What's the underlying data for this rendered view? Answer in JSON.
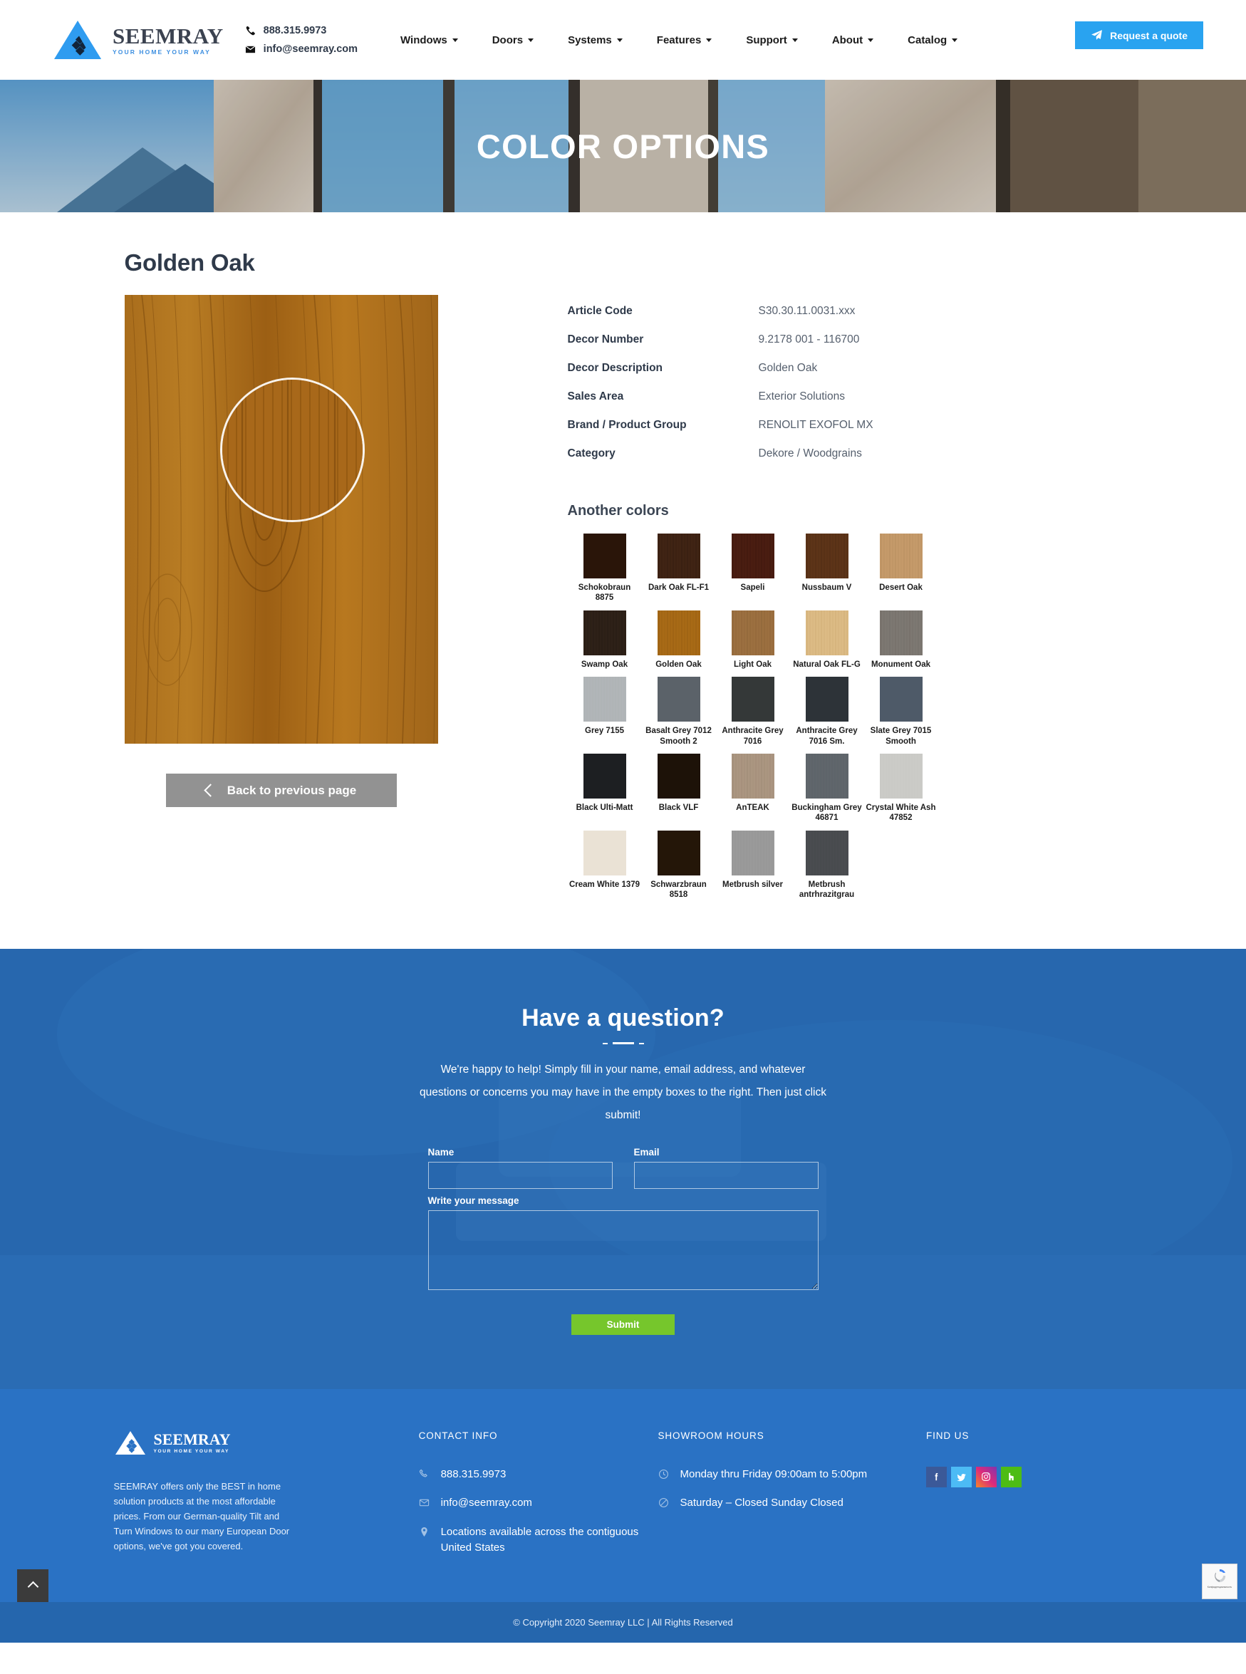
{
  "header": {
    "logo": {
      "name": "SEEMRAY",
      "tagline": "YOUR HOME YOUR WAY"
    },
    "phone": "888.315.9973",
    "email": "info@seemray.com",
    "nav": [
      {
        "label": "Windows"
      },
      {
        "label": "Doors"
      },
      {
        "label": "Systems"
      },
      {
        "label": "Features"
      },
      {
        "label": "Support"
      },
      {
        "label": "About"
      },
      {
        "label": "Catalog"
      }
    ],
    "quote_button": "Request a quote"
  },
  "hero": {
    "title": "COLOR OPTIONS"
  },
  "product": {
    "title": "Golden Oak",
    "back_button": "Back to previous page",
    "specs": [
      {
        "label": "Article Code",
        "value": "S30.30.11.0031.xxx"
      },
      {
        "label": "Decor Number",
        "value": "9.2178 001 - 116700"
      },
      {
        "label": "Decor Description",
        "value": "Golden Oak"
      },
      {
        "label": "Sales Area",
        "value": "Exterior Solutions"
      },
      {
        "label": "Brand / Product Group",
        "value": "RENOLIT EXOFOL MX"
      },
      {
        "label": "Category",
        "value": "Dekore / Woodgrains"
      }
    ]
  },
  "another_colors": {
    "title": "Another colors",
    "swatches": [
      {
        "label": "Schokobraun 8875",
        "base": "#2a1509",
        "tone": "#1a0c04",
        "grain": "none"
      },
      {
        "label": "Dark Oak FL-F1",
        "base": "#402414",
        "tone": "#22120a",
        "grain": "wood"
      },
      {
        "label": "Sapeli",
        "base": "#4a1d11",
        "tone": "#2c0f08",
        "grain": "wood"
      },
      {
        "label": "Nussbaum V",
        "base": "#5d3418",
        "tone": "#3b2010",
        "grain": "wood"
      },
      {
        "label": "Desert Oak",
        "base": "#c59a6a",
        "tone": "#a07c4f",
        "grain": "wood"
      },
      {
        "label": "Swamp Oak",
        "base": "#2e2118",
        "tone": "#19110c",
        "grain": "wood"
      },
      {
        "label": "Golden Oak",
        "base": "#a86a16",
        "tone": "#7e4c0c",
        "grain": "wood"
      },
      {
        "label": "Light Oak",
        "base": "#9c7040",
        "tone": "#79512b",
        "grain": "wood"
      },
      {
        "label": "Natural Oak FL-G",
        "base": "#dcbb85",
        "tone": "#bd9860",
        "grain": "wood"
      },
      {
        "label": "Monument Oak",
        "base": "#7d7872",
        "tone": "#635e59",
        "grain": "wood"
      },
      {
        "label": "Grey 7155",
        "base": "#b3b7ba",
        "tone": "#9ba0a4",
        "grain": "fine"
      },
      {
        "label": "Basalt Grey 7012 Smooth 2",
        "base": "#5b6269",
        "tone": "#4c5257",
        "grain": "none"
      },
      {
        "label": "Anthracite Grey 7016",
        "base": "#343838",
        "tone": "#272a2a",
        "grain": "none"
      },
      {
        "label": "Anthracite Grey 7016 Sm.",
        "base": "#2d3338",
        "tone": "#222629",
        "grain": "none"
      },
      {
        "label": "Slate Grey 7015 Smooth",
        "base": "#4e5a68",
        "tone": "#3d4754",
        "grain": "none"
      },
      {
        "label": "Black Ulti-Matt",
        "base": "#1d1f22",
        "tone": "#111214",
        "grain": "none"
      },
      {
        "label": "Black VLF",
        "base": "#1d1208",
        "tone": "#100a04",
        "grain": "none"
      },
      {
        "label": "AnTEAK",
        "base": "#ab9681",
        "tone": "#8c7865",
        "grain": "wood"
      },
      {
        "label": "Buckingham Grey 46871",
        "base": "#61686d",
        "tone": "#4e545a",
        "grain": "fine"
      },
      {
        "label": "Crystal White Ash 47852",
        "base": "#cdcdc9",
        "tone": "#b6b6b2",
        "grain": "fine"
      },
      {
        "label": "Cream White 1379",
        "base": "#eae2d5",
        "tone": "#d7cdbc",
        "grain": "none"
      },
      {
        "label": "Schwarzbraun 8518",
        "base": "#241608",
        "tone": "#140b03",
        "grain": "none"
      },
      {
        "label": "Metbrush silver",
        "base": "#9d9d9c",
        "tone": "#7f7f7e",
        "grain": "brush"
      },
      {
        "label": "Metbrush antrhrazitgrau",
        "base": "#4b4e51",
        "tone": "#3a3d40",
        "grain": "brush"
      }
    ]
  },
  "question": {
    "title": "Have a question?",
    "description": "We're happy to help! Simply fill in your name, email address, and whatever questions or concerns you may have in the empty boxes to the right. Then just click submit!",
    "name_label": "Name",
    "name_value": "",
    "email_label": "Email",
    "email_value": "",
    "message_label": "Write your message",
    "message_value": "",
    "submit_label": "Submit"
  },
  "footer": {
    "logo": {
      "name": "SEEMRAY",
      "tagline": "YOUR HOME YOUR WAY"
    },
    "about": "SEEMRAY offers only the BEST in home solution products at the most affordable prices. From our German-quality Tilt and Turn Windows to our many European Door options, we've got you covered.",
    "contact_heading": "CONTACT INFO",
    "contact_phone": "888.315.9973",
    "contact_email": "info@seemray.com",
    "contact_location": "Locations available across the contiguous United States",
    "hours_heading": "SHOWROOM HOURS",
    "hours_weekday": "Monday thru Friday 09:00am to 5:00pm",
    "hours_weekend": "Saturday – Closed Sunday Closed",
    "find_heading": "FIND US",
    "socials": [
      {
        "name": "facebook-icon",
        "color": "#3b5998"
      },
      {
        "name": "twitter-icon",
        "color": "#4cbbf5"
      },
      {
        "name": "instagram-icon",
        "color": "#c13584"
      },
      {
        "name": "houzz-icon",
        "color": "#4dbc15"
      }
    ],
    "copyright": "© Copyright 2020 Seemray LLC  |  All Rights Reserved",
    "recaptcha_text": "Конфиденциальность"
  },
  "colors": {
    "accent_blue": "#29a3f0",
    "footer_blue": "#2a72c4",
    "question_blue": "#2a6cb4",
    "submit_green": "#76c62c",
    "back_grey": "#929292"
  }
}
